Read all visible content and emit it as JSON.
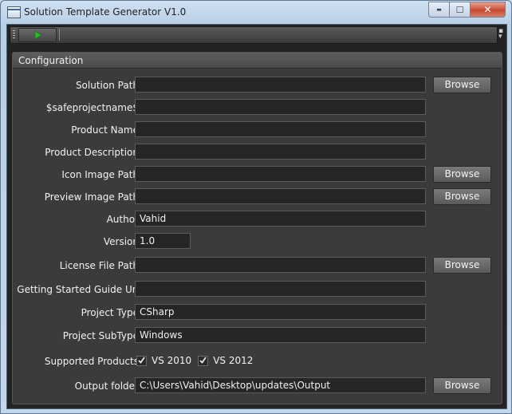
{
  "window": {
    "title": "Solution Template Generator V1.0"
  },
  "caption_buttons": {
    "minimize": "▬",
    "maximize": "☐",
    "close": "✕"
  },
  "toolbar": {
    "run_icon": "play-icon",
    "run_color": "#2fb52f"
  },
  "configuration": {
    "header": "Configuration",
    "browse_label": "Browse",
    "fields": {
      "solution_path": {
        "label": "Solution Path",
        "value": ""
      },
      "safeprojectname": {
        "label": "$safeprojectname$",
        "value": ""
      },
      "product_name": {
        "label": "Product Name",
        "value": ""
      },
      "product_description": {
        "label": "Product Description",
        "value": ""
      },
      "icon_image_path": {
        "label": "Icon Image Path",
        "value": ""
      },
      "preview_image_path": {
        "label": "Preview Image Path",
        "value": ""
      },
      "author": {
        "label": "Author",
        "value": "Vahid"
      },
      "version": {
        "label": "Version",
        "value": "1.0"
      },
      "license_file_path": {
        "label": "License File Path",
        "value": ""
      },
      "getting_started_url": {
        "label": "Getting Started Guide Url",
        "value": ""
      },
      "project_type": {
        "label": "Project Type",
        "value": "CSharp"
      },
      "project_subtype": {
        "label": "Project SubType",
        "value": "Windows"
      },
      "output_folder": {
        "label": "Output folder",
        "value": "C:\\Users\\Vahid\\Desktop\\updates\\Output"
      }
    },
    "supported_products": {
      "label": "Supported Products",
      "options": [
        {
          "label": "VS 2010",
          "checked": true
        },
        {
          "label": "VS 2012",
          "checked": true
        }
      ]
    }
  },
  "colors": {
    "panel_bg": "#3b3b3b",
    "field_bg": "#262626",
    "text": "#f2f2f2"
  }
}
